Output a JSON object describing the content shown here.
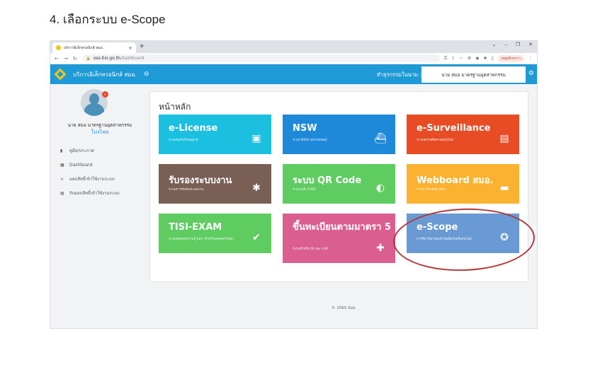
{
  "doc_heading": "4. เลือกระบบ e-Scope",
  "browser": {
    "tab_title": "บริการอิเล็กทรอนิกส์ สมอ.",
    "tab_close": "×",
    "new_tab": "+",
    "url_host": "sso.tisi.go.th",
    "url_path": "/dashboard",
    "profile_chip": "หยุดชั่วคราว"
  },
  "header": {
    "title": "บริการอิเล็กทรอนิกส์ สมอ.",
    "business_label": "ทำธุรกรรมในนาม :",
    "company": "นาย สมอ มาตรฐานอุตสาหกรรม"
  },
  "sidebar": {
    "user_name": "นาย สมอ มาตรฐานอุตสาหกรรม",
    "profile_link": "โปรไฟล",
    "items": [
      {
        "label": "คู่มือ/ประกาศ"
      },
      {
        "label": "Dashboard"
      },
      {
        "label": "มอบสิทธิ์เข้าใช้งานระบบ"
      },
      {
        "label": "รับมอบสิทธิ์เข้าใช้งานระบบ"
      }
    ]
  },
  "main": {
    "panel_title": "หน้าหลัก",
    "tiles": [
      {
        "title": "e-License",
        "subtitle": "ระบบขอรับใบอนุญาต",
        "color": "#1bbfe0"
      },
      {
        "title": "NSW",
        "subtitle": "ระบบ NSW (ตรวจปล่อย)",
        "color": "#1e88d9"
      },
      {
        "title": "e-Surveillance",
        "subtitle": "ระบบตรวจติดตามออนไลน์",
        "color": "#e84c25"
      },
      {
        "title": "รับรองระบบงาน",
        "subtitle": "ระบบการรับรองระบบงาน",
        "color": "#7a5f55"
      },
      {
        "title": "ระบบ QR Code",
        "subtitle": "ระบบ QR CODE",
        "color": "#5fcc62"
      },
      {
        "title": "Webboard สมอ.",
        "subtitle": "ระบบ เว็บบอร์ด สมอ.",
        "color": "#fbb230"
      },
      {
        "title": "TISI-EXAM",
        "subtitle": "ระบบทดสอบความรู้ มอก. สำหรับบุคคลธรรมดา",
        "color": "#5fcc62"
      },
      {
        "title": "ขึ้นทะเบียนตามมาตรา 5",
        "subtitle": "ระบบสำหรับ IB และ LAB",
        "color": "#da5f8f"
      },
      {
        "title": "e-Scope",
        "subtitle": "การพิจารณาขอบข่ายผลิตภัณฑ์ออนไลน์",
        "color": "#6a9ad4"
      }
    ]
  },
  "footer": "© 2565 สมอ.",
  "icons": {
    "tile_icons": [
      "certificate-icon",
      "ship-icon",
      "clipboard-icon",
      "badge-card-icon",
      "lightbulb-icon",
      "chat-icon",
      "check-shield-icon",
      "plus-bookmark-icon",
      "award-icon"
    ]
  }
}
